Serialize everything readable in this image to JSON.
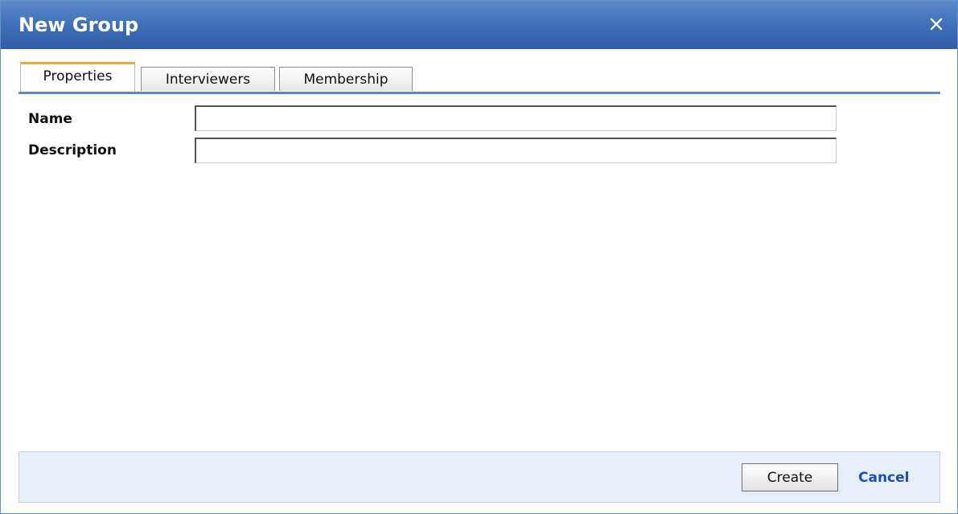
{
  "dialog": {
    "title": "New Group",
    "close_icon": "close-icon"
  },
  "tabs": [
    {
      "label": "Properties",
      "active": true
    },
    {
      "label": "Interviewers",
      "active": false
    },
    {
      "label": "Membership",
      "active": false
    }
  ],
  "form": {
    "name_label": "Name",
    "name_value": "",
    "description_label": "Description",
    "description_value": ""
  },
  "footer": {
    "create_label": "Create",
    "cancel_label": "Cancel"
  },
  "colors": {
    "titlebar": "#3c6db5",
    "active_tab_accent": "#f0a830",
    "tab_rule": "#5d86c6",
    "footer_bg": "#e6eefa",
    "link": "#1f4fa8"
  }
}
